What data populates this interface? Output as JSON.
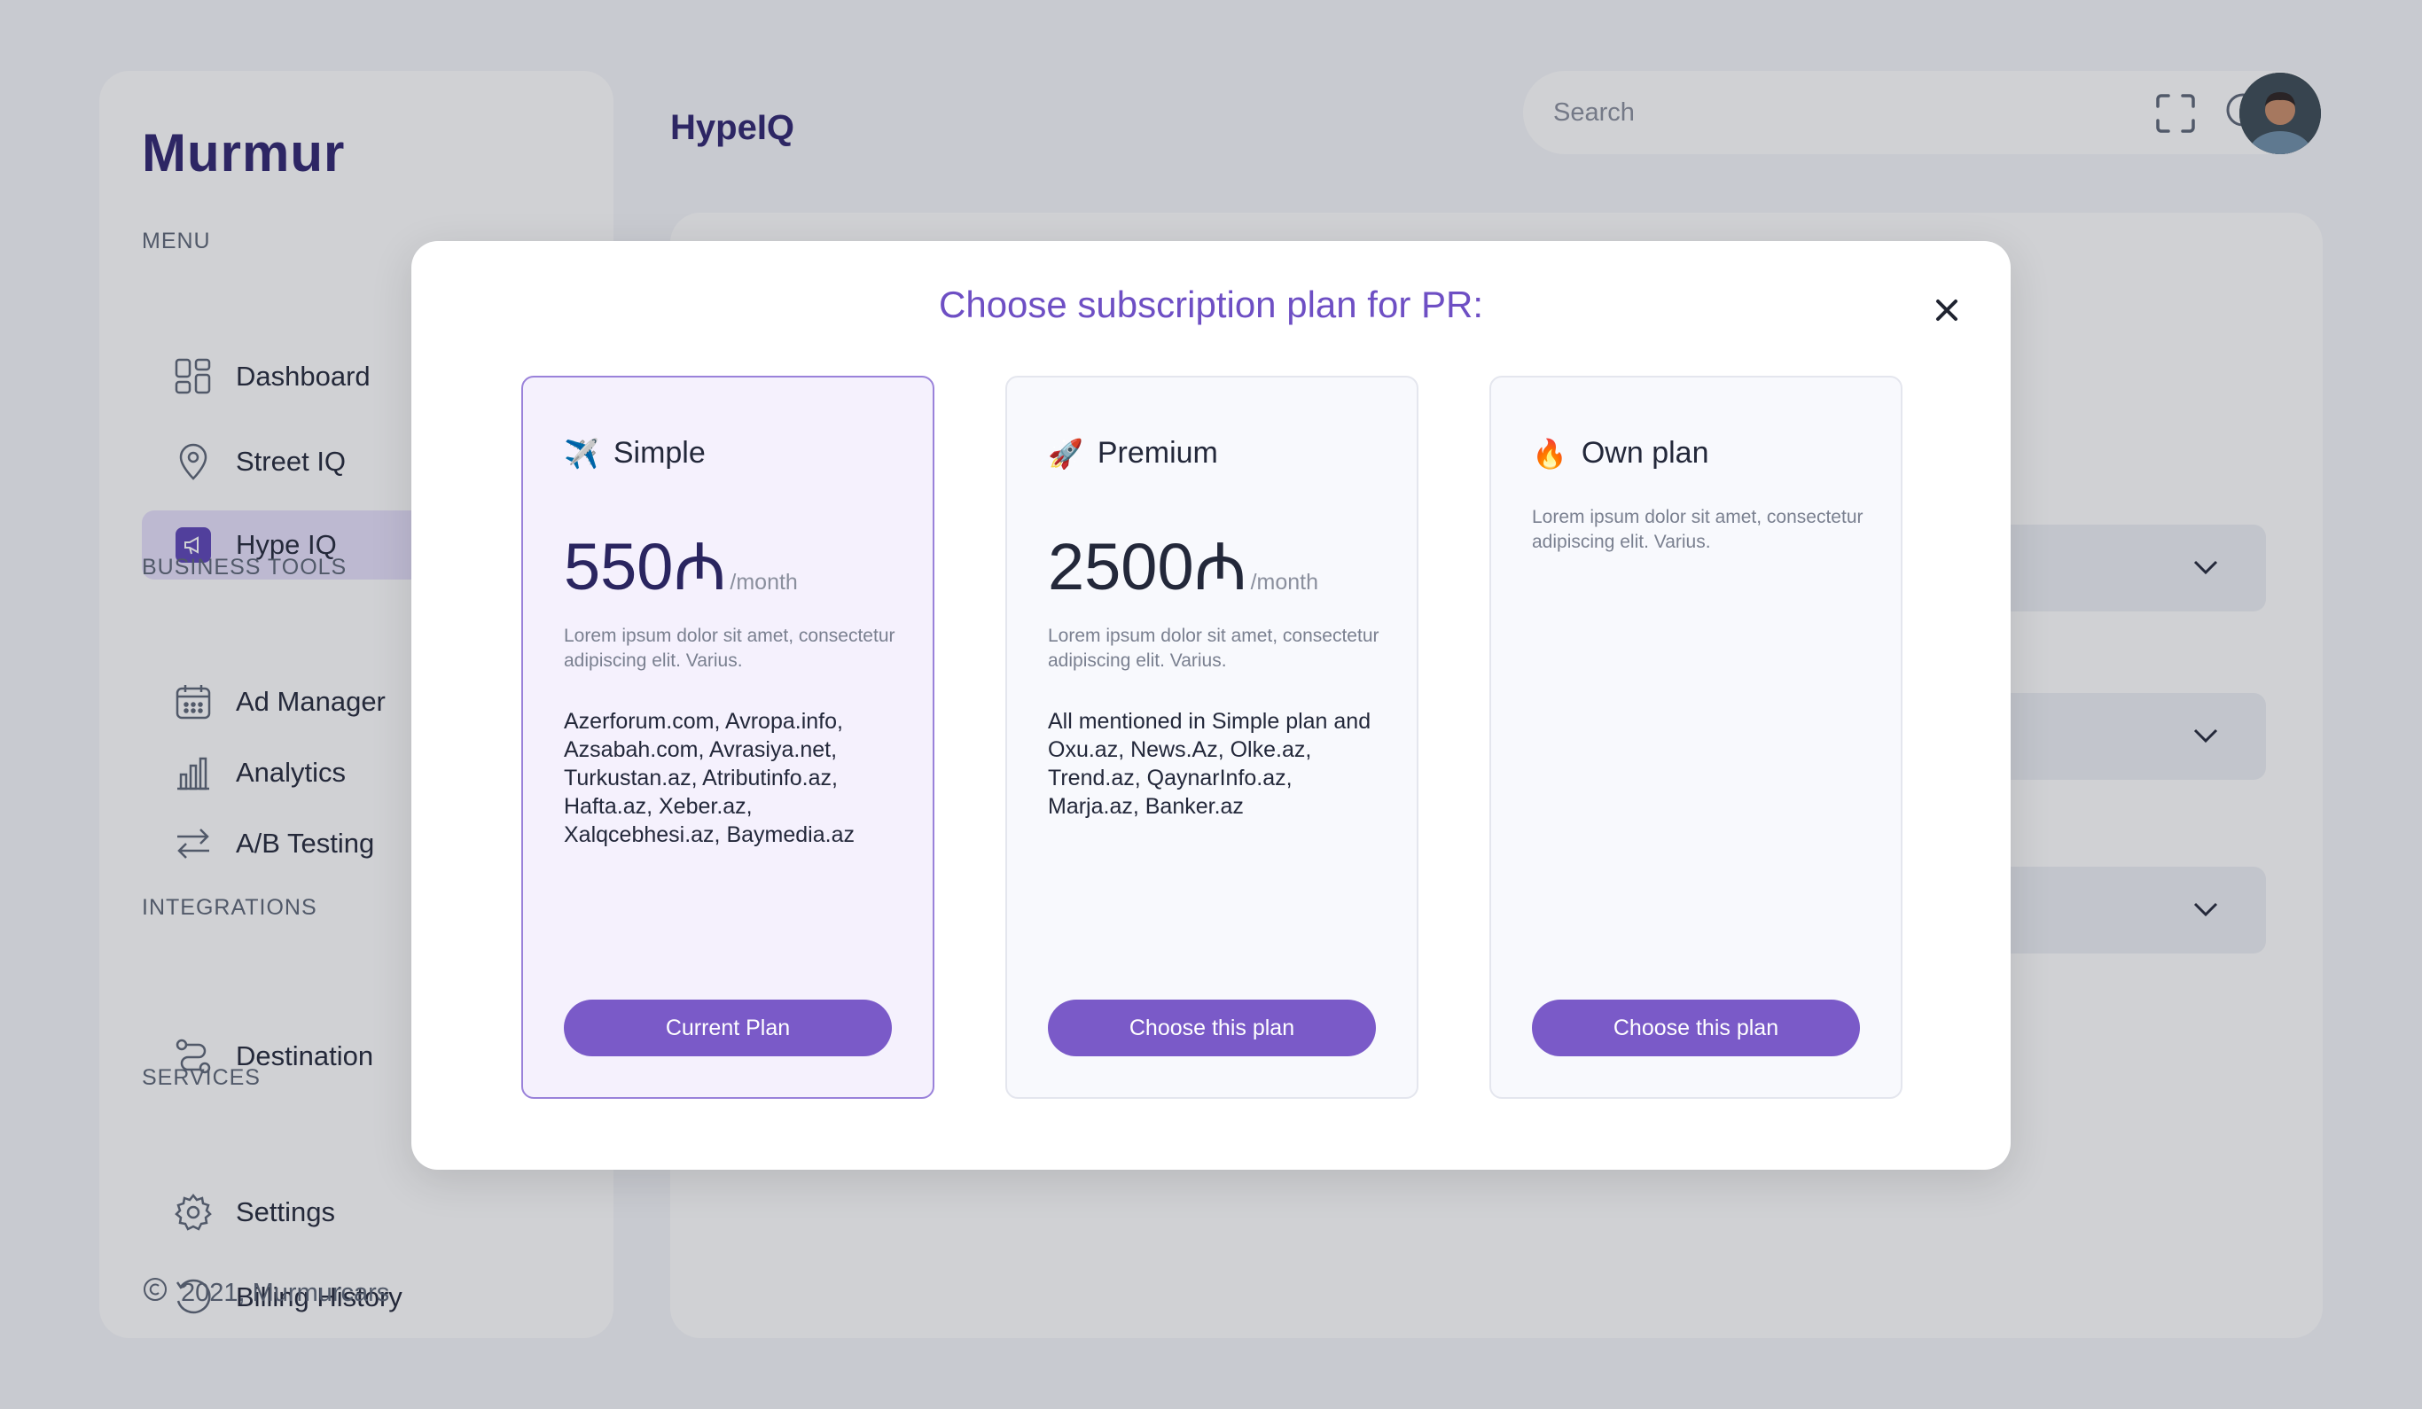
{
  "app": {
    "logo": "Murmur"
  },
  "header": {
    "title": "HypeIQ",
    "search_placeholder": "Search"
  },
  "sidebar": {
    "sections": {
      "menu": "MENU",
      "business_tools": "BUSINESS TOOLS",
      "integrations": "INTEGRATIONS",
      "services": "SERVICES"
    },
    "items": [
      {
        "label": "Dashboard",
        "icon": "dashboard-icon"
      },
      {
        "label": "Street IQ",
        "icon": "location-pin-icon"
      },
      {
        "label": "Hype IQ",
        "icon": "megaphone-icon",
        "active": true
      },
      {
        "label": "Ad Manager",
        "icon": "calendar-icon"
      },
      {
        "label": "Analytics",
        "icon": "bar-chart-icon"
      },
      {
        "label": "A/B Testing",
        "icon": "swap-arrows-icon"
      },
      {
        "label": "Destination",
        "icon": "route-icon"
      },
      {
        "label": "Settings",
        "icon": "gear-icon"
      },
      {
        "label": "Billing History",
        "icon": "history-icon"
      }
    ],
    "footer": "2021, Murmurcars"
  },
  "modal": {
    "title": "Choose subscription plan for PR:",
    "plans": [
      {
        "name": "Simple",
        "emoji": "✈️",
        "price": "550₼",
        "period": "/month",
        "description": "Lorem ipsum dolor sit amet, consectetur adipiscing elit. Varius.",
        "sites": "Azerforum.com, Avropa.info, Azsabah.com, Avrasiya.net, Turkustan.az, Atributinfo.az, Hafta.az, Xeber.az, Xalqcebhesi.az, Baymedia.az",
        "button": "Current Plan"
      },
      {
        "name": "Premium",
        "emoji": "🚀",
        "price": "2500₼",
        "period": "/month",
        "description": "Lorem ipsum dolor sit amet, consectetur adipiscing elit. Varius.",
        "sites": "All mentioned in Simple plan and Oxu.az, News.Az, Olke.az, Trend.az, QaynarInfo.az, Marja.az, Banker.az",
        "button": "Choose this plan"
      },
      {
        "name": "Own plan",
        "emoji": "🔥",
        "description": "Lorem ipsum dolor sit amet, consectetur adipiscing elit. Varius.",
        "button": "Choose this plan"
      }
    ]
  },
  "colors": {
    "brand": "#2f2470",
    "accent": "#7a5ac8",
    "active_nav_bg": "#e7e0fb"
  }
}
